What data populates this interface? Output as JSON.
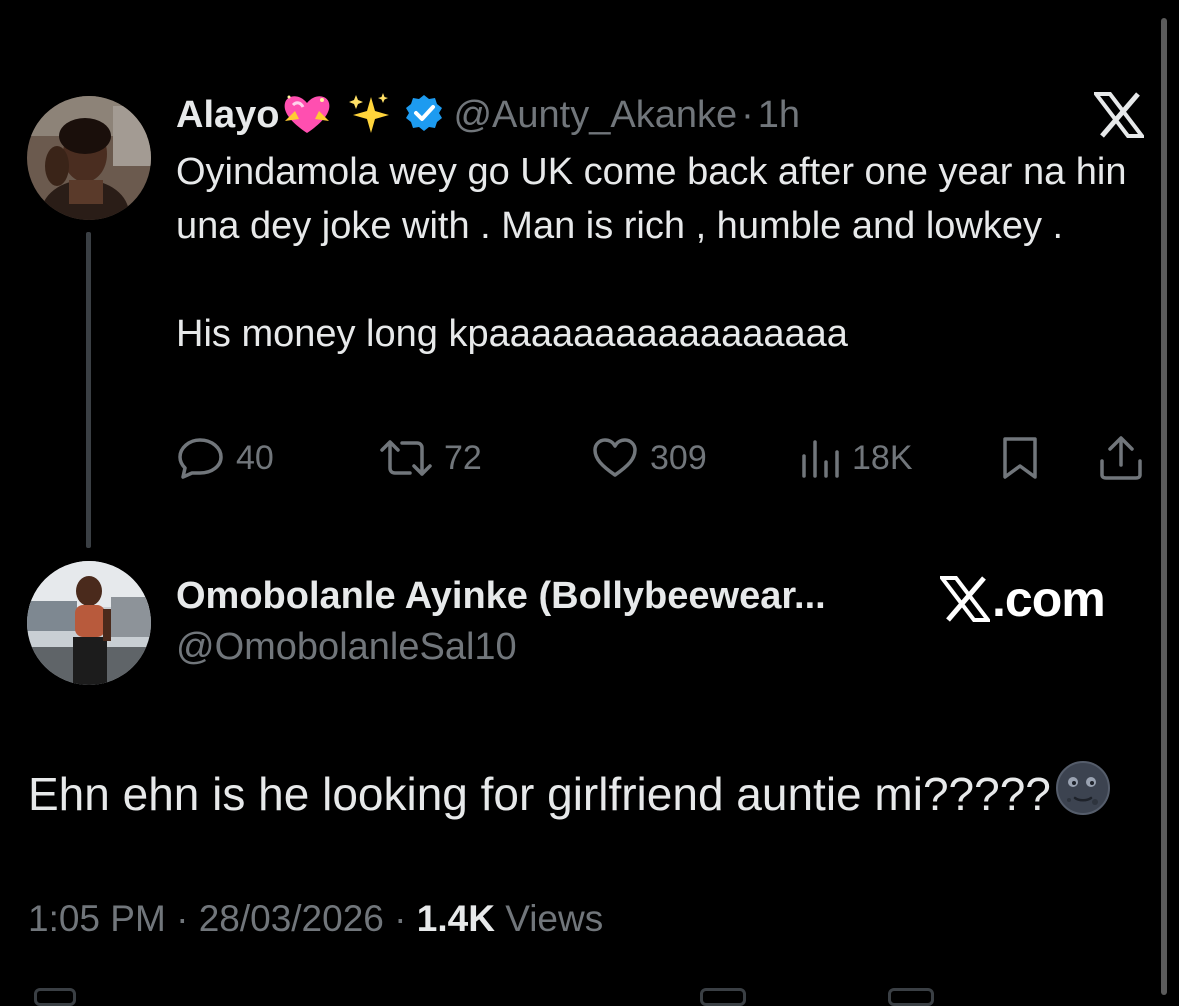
{
  "colors": {
    "background": "#000000",
    "primary_text": "#e7e9ea",
    "secondary_text": "#71767b",
    "verified_blue": "#1d9bf0",
    "thread_line": "#3a3f44"
  },
  "tweet": {
    "author": {
      "display_name": "Alayo",
      "name_emojis": [
        "heart-with-ribbon-emoji",
        "sparkles-emoji"
      ],
      "verified": true,
      "handle": "@Aunty_Akanke",
      "separator": "·",
      "time": "1h"
    },
    "text_paragraph_1": "Oyindamola wey go UK come back after one year na hin una dey joke with . Man is rich , humble and lowkey .",
    "text_paragraph_2": "His money long kpaaaaaaaaaaaaaaaaa",
    "actions": {
      "reply_count": "40",
      "retweet_count": "72",
      "like_count": "309",
      "views_count": "18K"
    },
    "logo_icon": "x-logo-icon"
  },
  "reply": {
    "author": {
      "display_name": "Omobolanle Ayinke (Bollybeewear...",
      "handle": "@OmobolanleSal10"
    },
    "brand_text": ".com",
    "text": "Ehn ehn is he looking for girlfriend auntie mi?????",
    "emoji": "new-moon-face-emoji",
    "meta": {
      "time": "1:05 PM",
      "separator": "·",
      "date": "28/03/2026",
      "views_count": "1.4K",
      "views_label": "Views"
    }
  }
}
